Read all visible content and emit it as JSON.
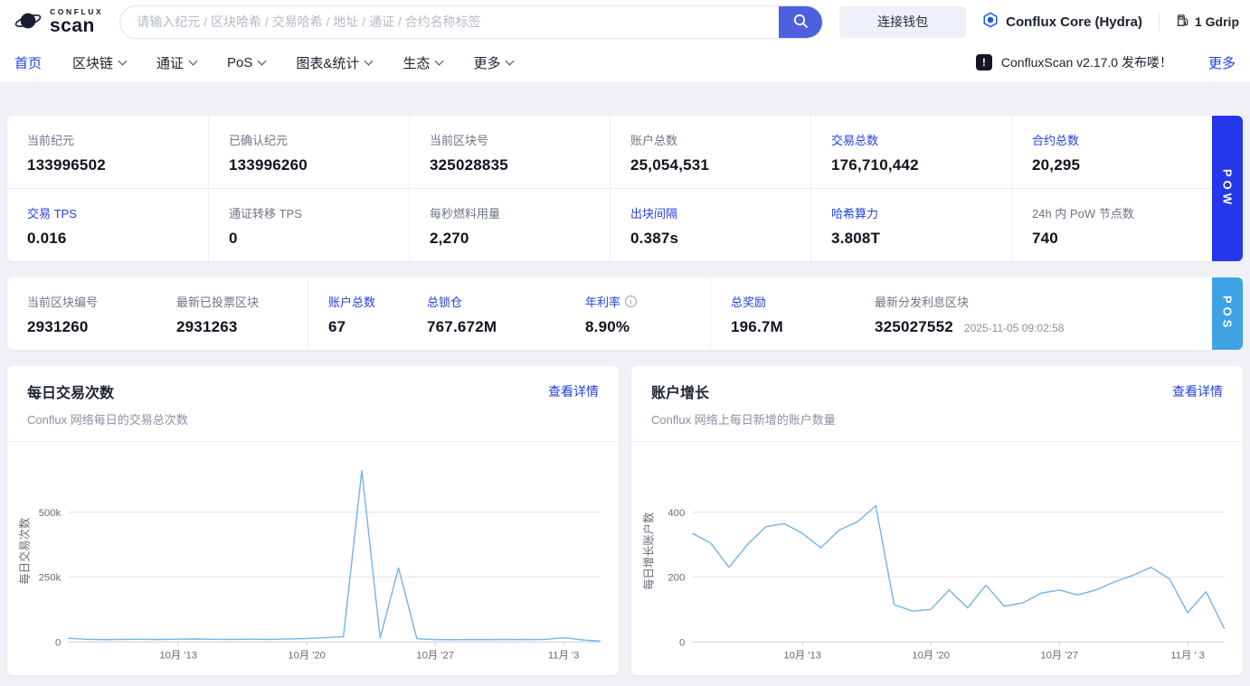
{
  "colors": {
    "accent": "#2141e6",
    "pow-tab": "#2438ea",
    "pos-tab": "#3ea2e5"
  },
  "header": {
    "logo_top": "CONFLUX",
    "logo_bottom": "scan",
    "search_placeholder": "请输入纪元 / 区块哈希 / 交易哈希 / 地址 / 通证 / 合约名称标签",
    "connect_wallet_label": "连接钱包",
    "network_label": "Conflux Core (Hydra)",
    "gas_label": "1 Gdrip"
  },
  "nav": {
    "items": [
      {
        "label": "首页"
      },
      {
        "label": "区块链"
      },
      {
        "label": "通证"
      },
      {
        "label": "PoS"
      },
      {
        "label": "图表&统计"
      },
      {
        "label": "生态"
      },
      {
        "label": "更多"
      }
    ],
    "announcement_text": "ConfluxScan v2.17.0 发布喽！",
    "more_label": "更多"
  },
  "pow": {
    "tab_label": "POW",
    "row1": [
      {
        "label": "当前纪元",
        "value": "133996502"
      },
      {
        "label": "已确认纪元",
        "value": "133996260"
      },
      {
        "label": "当前区块号",
        "value": "325028835"
      },
      {
        "label": "账户总数",
        "value": "25,054,531"
      },
      {
        "label": "交易总数",
        "value": "176,710,442"
      },
      {
        "label": "合约总数",
        "value": "20,295"
      }
    ],
    "row2": [
      {
        "label": "交易 TPS",
        "value": "0.016"
      },
      {
        "label": "通证转移 TPS",
        "value": "0"
      },
      {
        "label": "每秒燃料用量",
        "value": "2,270"
      },
      {
        "label": "出块间隔",
        "value": "0.387s"
      },
      {
        "label": "哈希算力",
        "value": "3.808T"
      },
      {
        "label": "24h 内 PoW 节点数",
        "value": "740"
      }
    ]
  },
  "pos": {
    "tab_label": "POS",
    "stats": [
      {
        "label": "当前区块编号",
        "value": "2931260"
      },
      {
        "label": "最新已投票区块",
        "value": "2931263"
      },
      {
        "label": "账户总数",
        "value": "67"
      },
      {
        "label": "总锁仓",
        "value": "767.672M"
      },
      {
        "label": "年利率",
        "value": "8.90%"
      },
      {
        "label": "总奖励",
        "value": "196.7M"
      },
      {
        "label": "最新分发利息区块",
        "value": "325027552",
        "timestamp": "2025-11-05 09:02:58"
      }
    ]
  },
  "chart_data": [
    {
      "type": "line",
      "title": "每日交易次数",
      "subtitle": "Conflux 网络每日的交易总次数",
      "detail_link": "查看详情",
      "ylabel": "每日交易次数",
      "xlabel": "",
      "x": [
        "10-07",
        "10-08",
        "10-09",
        "10-10",
        "10-11",
        "10-12",
        "10-13",
        "10-14",
        "10-15",
        "10-16",
        "10-17",
        "10-18",
        "10-19",
        "10-20",
        "10-21",
        "10-22",
        "10-23",
        "10-24",
        "10-25",
        "10-26",
        "10-27",
        "10-28",
        "10-29",
        "10-30",
        "10-31",
        "11-01",
        "11-02",
        "11-03",
        "11-04",
        "11-05"
      ],
      "values": [
        14000,
        10000,
        9000,
        9500,
        10000,
        9200,
        10500,
        11000,
        10000,
        9600,
        10200,
        9800,
        11500,
        13000,
        16000,
        20000,
        660000,
        15000,
        285000,
        12000,
        9000,
        8500,
        9000,
        8800,
        9200,
        9000,
        9500,
        16000,
        8000,
        3000
      ],
      "ylim": [
        0,
        700000
      ],
      "yticks": [
        {
          "v": 0,
          "label": "0"
        },
        {
          "v": 250000,
          "label": "250k"
        },
        {
          "v": 500000,
          "label": "500k"
        }
      ],
      "xticks": [
        {
          "i": 6,
          "label": "10月 '13"
        },
        {
          "i": 13,
          "label": "10月 '20"
        },
        {
          "i": 20,
          "label": "10月 '27"
        },
        {
          "i": 27,
          "label": "11月 '3"
        }
      ],
      "line_color": "#74b6e8",
      "grid": true,
      "legend": "none"
    },
    {
      "type": "line",
      "title": "账户增长",
      "subtitle": "Conflux 网络上每日新增的账户数量",
      "detail_link": "查看详情",
      "ylabel": "每日增长账户数",
      "xlabel": "",
      "x": [
        "10-07",
        "10-08",
        "10-09",
        "10-10",
        "10-11",
        "10-12",
        "10-13",
        "10-14",
        "10-15",
        "10-16",
        "10-17",
        "10-18",
        "10-19",
        "10-20",
        "10-21",
        "10-22",
        "10-23",
        "10-24",
        "10-25",
        "10-26",
        "10-27",
        "10-28",
        "10-29",
        "10-30",
        "10-31",
        "11-01",
        "11-02",
        "11-03",
        "11-04",
        "11-05"
      ],
      "values": [
        335,
        305,
        230,
        300,
        355,
        365,
        335,
        290,
        345,
        370,
        420,
        115,
        95,
        100,
        160,
        105,
        175,
        110,
        120,
        150,
        160,
        145,
        160,
        185,
        205,
        230,
        195,
        90,
        155,
        40
      ],
      "ylim": [
        0,
        560
      ],
      "yticks": [
        {
          "v": 0,
          "label": "0"
        },
        {
          "v": 200,
          "label": "200"
        },
        {
          "v": 400,
          "label": "400"
        }
      ],
      "xticks": [
        {
          "i": 6,
          "label": "10月 '13"
        },
        {
          "i": 13,
          "label": "10月 '20"
        },
        {
          "i": 20,
          "label": "10月 '27"
        },
        {
          "i": 27,
          "label": "11月 ' 3"
        }
      ],
      "line_color": "#74b6e8",
      "grid": true,
      "legend": "none"
    }
  ]
}
